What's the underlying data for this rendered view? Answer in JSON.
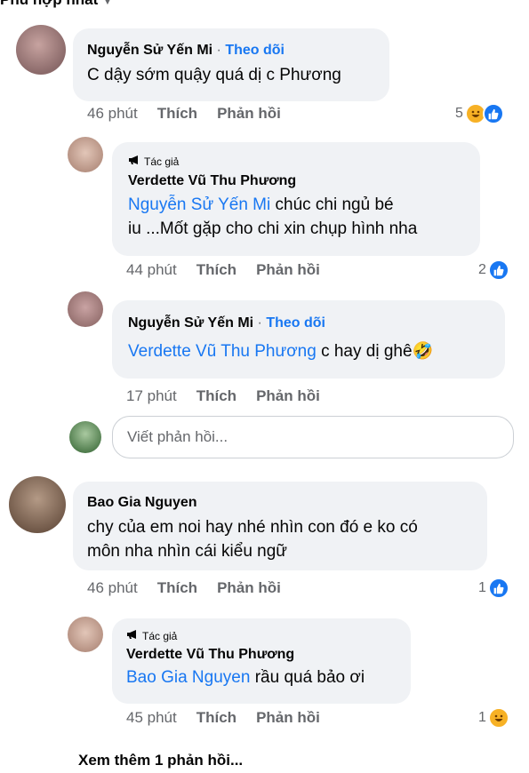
{
  "sort_label": "Phù hợp nhất",
  "comments": [
    {
      "name": "Nguyễn Sử Yến Mi",
      "follow": "Theo dõi",
      "text": "C dậy sớm quậy quá dị c Phương",
      "time": "46 phút",
      "like": "Thích",
      "reply": "Phản hồi",
      "react_count": "5"
    },
    {
      "author_badge": "Tác giả",
      "name": "Verdette Vũ Thu Phương",
      "mention": "Nguyễn Sử Yến Mi",
      "text_1": " chúc chi ngủ bé",
      "text_2": "iu ...Mốt gặp cho chi xin chụp hình nha",
      "time": "44 phút",
      "like": "Thích",
      "reply": "Phản hồi",
      "react_count": "2"
    },
    {
      "name": "Nguyễn Sử Yến Mi",
      "follow": "Theo dõi",
      "mention": "Verdette Vũ Thu Phương",
      "text": " c hay  dị ghê🤣",
      "time": "17 phút",
      "like": "Thích",
      "reply": "Phản hồi"
    },
    {
      "name": "Bao Gia Nguyen",
      "text_1": "chy của em noi hay nhé nhìn con đó e ko có",
      "text_2": "môn nha nhìn cái kiểu ngữ",
      "time": "46 phút",
      "like": "Thích",
      "reply": "Phản hồi",
      "react_count": "1"
    },
    {
      "author_badge": "Tác giả",
      "name": "Verdette Vũ Thu Phương",
      "mention": "Bao Gia Nguyen",
      "text": " rầu quá bảo ơi",
      "time": "45 phút",
      "like": "Thích",
      "reply": "Phản hồi",
      "react_count": "1"
    }
  ],
  "reply_placeholder": "Viết phản hồi...",
  "view_more": "Xem thêm 1 phản hồi..."
}
